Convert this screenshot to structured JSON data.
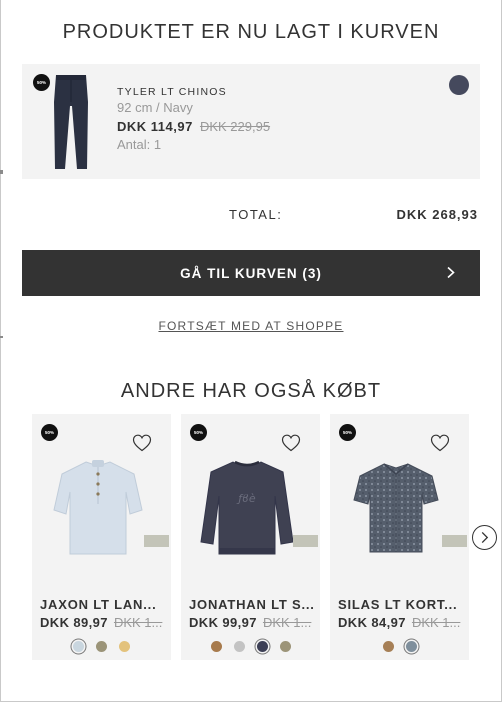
{
  "modal": {
    "title": "PRODUKTET ER NU LAGT I KURVEN",
    "cart_item": {
      "badge": "50%",
      "name": "TYLER LT CHINOS",
      "variant": "92 cm / Navy",
      "price": "DKK 114,97",
      "old_price": "DKK 229,95",
      "quantity": "Antal: 1",
      "swatch_color": "#45495d",
      "image_icon": "navy-chinos"
    },
    "total": {
      "label": "TOTAL:",
      "value": "DKK 268,93"
    },
    "checkout_button": {
      "label": "GÅ TIL KURVEN (3)",
      "icon": "chevron-right-icon"
    },
    "continue_link": "FORTSÆT MED AT SHOPPE",
    "recommendations": {
      "title": "ANDRE HAR OGSÅ KØBT",
      "products": [
        {
          "badge": "50%",
          "name": "JAXON LT LAN...",
          "price": "DKK 89,97",
          "old_price": "DKK 1...",
          "image_icon": "light-blue-shirt",
          "colors": [
            "#c9d6df",
            "#9b9478",
            "#e3c27c"
          ],
          "selected_color": 0
        },
        {
          "badge": "50%",
          "name": "JONATHAN LT S...",
          "price": "DKK 99,97",
          "old_price": "DKK 1...",
          "image_icon": "dark-sweatshirt",
          "colors": [
            "#a77a4c",
            "#c3c3c3",
            "#3c3f55",
            "#9c9478"
          ],
          "selected_color": 2
        },
        {
          "badge": "50%",
          "name": "SILAS LT KORT...",
          "price": "DKK 84,97",
          "old_price": "DKK 1...",
          "image_icon": "patterned-shirt",
          "colors": [
            "#a67f56",
            "#7f8f9c"
          ],
          "selected_color": 1
        }
      ],
      "next_icon": "chevron-right-icon"
    }
  }
}
